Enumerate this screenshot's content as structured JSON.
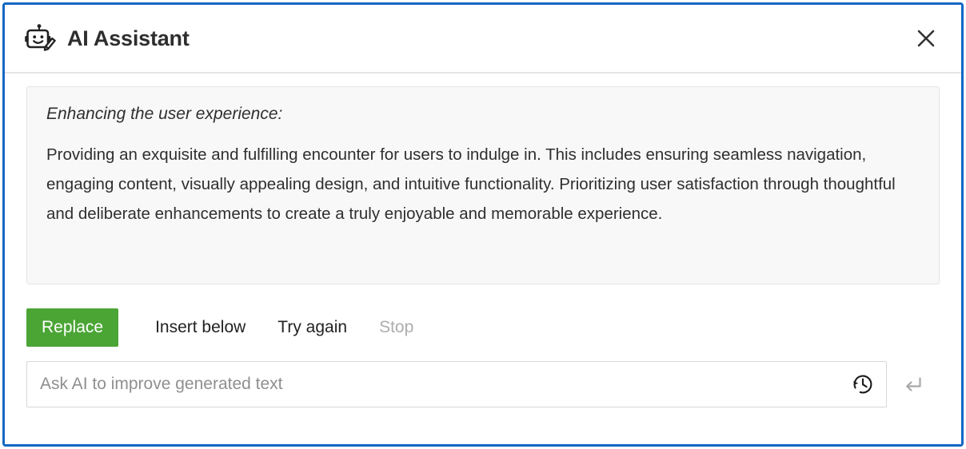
{
  "dialog": {
    "accent_border_color": "#1166c4",
    "header": {
      "icon": "robot-pencil-icon",
      "title": "AI Assistant",
      "close_icon": "close-icon",
      "close_label": "Close"
    },
    "result": {
      "title": "Enhancing the user experience:",
      "paragraph": "Providing an exquisite and fulfilling encounter for users to indulge in. This includes ensuring seamless navigation, engaging content, visually appealing design, and intuitive functionality. Prioritizing user satisfaction through thoughtful and deliberate enhancements to create a truly enjoyable and memorable experience.",
      "background_color": "#f8f8f8"
    },
    "actions": [
      {
        "label": "Replace",
        "style": "primary",
        "color": "#4ba535",
        "enabled": true
      },
      {
        "label": "Insert below",
        "style": "plain",
        "enabled": true
      },
      {
        "label": "Try again",
        "style": "plain",
        "enabled": true
      },
      {
        "label": "Stop",
        "style": "disabled",
        "color": "#adadad",
        "enabled": false
      }
    ],
    "prompt": {
      "placeholder": "Ask AI to improve generated text",
      "value": "",
      "history_icon": "history-clock-icon",
      "history_label": "History",
      "submit_icon": "enter-arrow-icon",
      "submit_label": "Submit"
    }
  }
}
